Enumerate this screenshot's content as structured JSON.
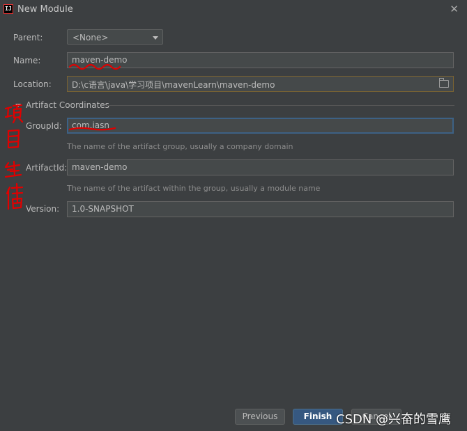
{
  "window": {
    "title": "New Module",
    "app_icon": "intellij-icon",
    "close_glyph": "✕"
  },
  "form": {
    "parent_label": "Parent:",
    "parent_value": "<None>",
    "name_label": "Name:",
    "name_value": "maven-demo",
    "location_label": "Location:",
    "location_value": "D:\\c语言\\java\\学习项目\\mavenLearn\\maven-demo"
  },
  "artifact": {
    "section_title": "Artifact Coordinates",
    "groupid_label": "GroupId:",
    "groupid_value": "com.iasn",
    "groupid_hint": "The name of the artifact group, usually a company domain",
    "artifactid_label": "ArtifactId:",
    "artifactid_value": "maven-demo",
    "artifactid_hint": "The name of the artifact within the group, usually a module name",
    "version_label": "Version:",
    "version_value": "1.0-SNAPSHOT"
  },
  "buttons": {
    "previous": "Previous",
    "finish": "Finish",
    "cancel": "Cancel"
  },
  "annotation": {
    "handwritten_note": "项目坐标",
    "color": "#ff0000"
  },
  "watermark": "CSDN @兴奋的雪鹰"
}
